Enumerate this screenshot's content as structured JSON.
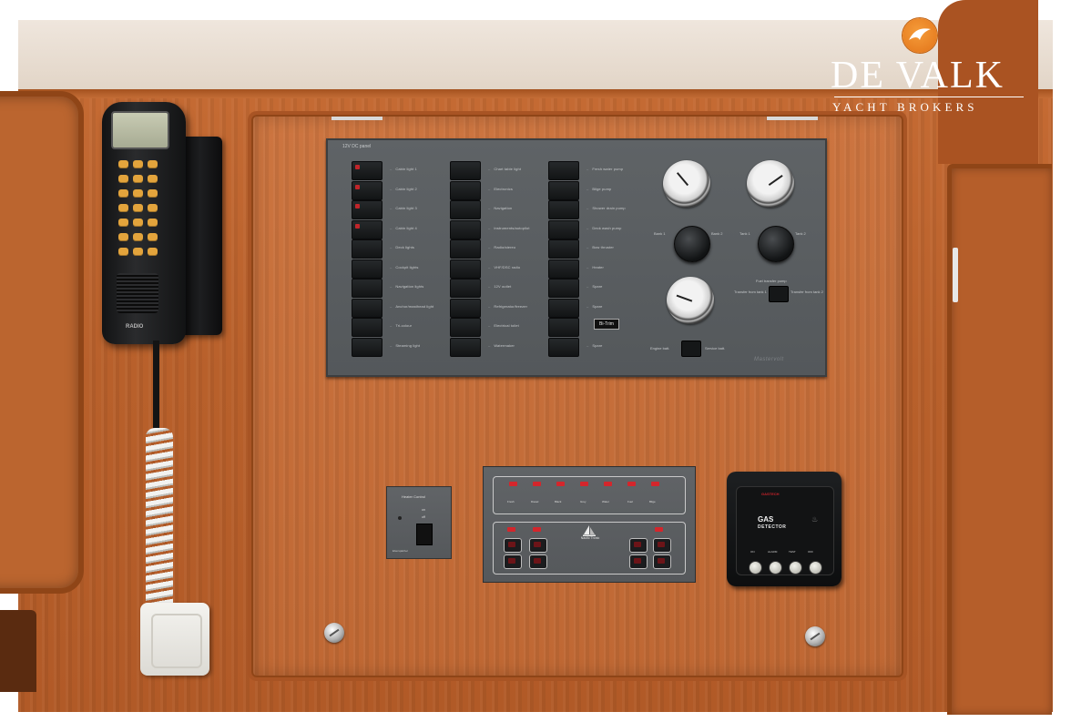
{
  "logo": {
    "name": "DE VALK",
    "tagline": "YACHT BROKERS",
    "brand_color": "#E87A1E"
  },
  "switch_panel": {
    "title": "12V DC panel",
    "columns": [
      {
        "switches": [
          {
            "label": "Cabin light 1",
            "red": true
          },
          {
            "label": "Cabin light 2",
            "red": true
          },
          {
            "label": "Cabin light 3",
            "red": true
          },
          {
            "label": "Cabin light 4",
            "red": true
          },
          {
            "label": "Deck lights",
            "red": false
          },
          {
            "label": "Cockpit lights",
            "red": false
          },
          {
            "label": "Navigation lights",
            "red": false
          },
          {
            "label": "Anchor/masthead light",
            "red": false
          },
          {
            "label": "Tri-colour",
            "red": false
          },
          {
            "label": "Steaming light",
            "red": false
          }
        ]
      },
      {
        "switches": [
          {
            "label": "Chart table light",
            "red": false
          },
          {
            "label": "Electronics",
            "red": false
          },
          {
            "label": "Navigation",
            "red": false
          },
          {
            "label": "Instruments/autopilot",
            "red": false
          },
          {
            "label": "Radio/stereo",
            "red": false
          },
          {
            "label": "VHF/DSC radio",
            "red": false
          },
          {
            "label": "12V outlet",
            "red": false
          },
          {
            "label": "Refrigerator/freezer",
            "red": false
          },
          {
            "label": "Electrical toilet",
            "red": false
          },
          {
            "label": "Watermaker",
            "red": false
          }
        ]
      },
      {
        "switches": [
          {
            "label": "Fresh water pump",
            "red": false
          },
          {
            "label": "Bilge pump",
            "red": false
          },
          {
            "label": "Shower drain pump",
            "red": false
          },
          {
            "label": "Deck wash pump",
            "red": false
          },
          {
            "label": "Bow thruster",
            "red": false
          },
          {
            "label": "Heater",
            "red": false
          },
          {
            "label": "Spare",
            "red": false
          },
          {
            "label": "Spare",
            "red": false
          },
          {
            "label": "Spare",
            "red": false
          },
          {
            "label": "Spare",
            "red": false
          }
        ],
        "badge": "Bi-Trim"
      }
    ],
    "gauges": [
      {
        "name": "battery-voltmeter"
      },
      {
        "name": "tank-gauge"
      },
      {
        "name": "ammeter"
      }
    ],
    "knob1_labels": [
      "Bank 1",
      "Bank 2"
    ],
    "knob2_labels": [
      "Tank 1",
      "Tank 2"
    ],
    "fuel_label": "Fuel transfer pump",
    "fuel_left": "Transfer from tank 1",
    "fuel_right": "Transfer from tank 2",
    "engine_left": "Engine batt.",
    "engine_right": "Service batt.",
    "maker": "Mastervolt"
  },
  "heater_control": {
    "title": "Heater Control",
    "on_label": "on",
    "off_label": "off",
    "maker": "Eberspächer"
  },
  "tank_panel": {
    "top_labels": [
      "Fresh",
      "Diesel",
      "Black",
      "Grey",
      "Water",
      "Fuel",
      "Bilge"
    ],
    "brand": "Nautic Tronic"
  },
  "gas_detector": {
    "maker": "GASTECH",
    "title": "GAS",
    "subtitle": "DETECTOR",
    "buttons": [
      "ON",
      "ALARM",
      "TEST",
      "OFF"
    ]
  },
  "handset": {
    "maker": "RADIO"
  }
}
